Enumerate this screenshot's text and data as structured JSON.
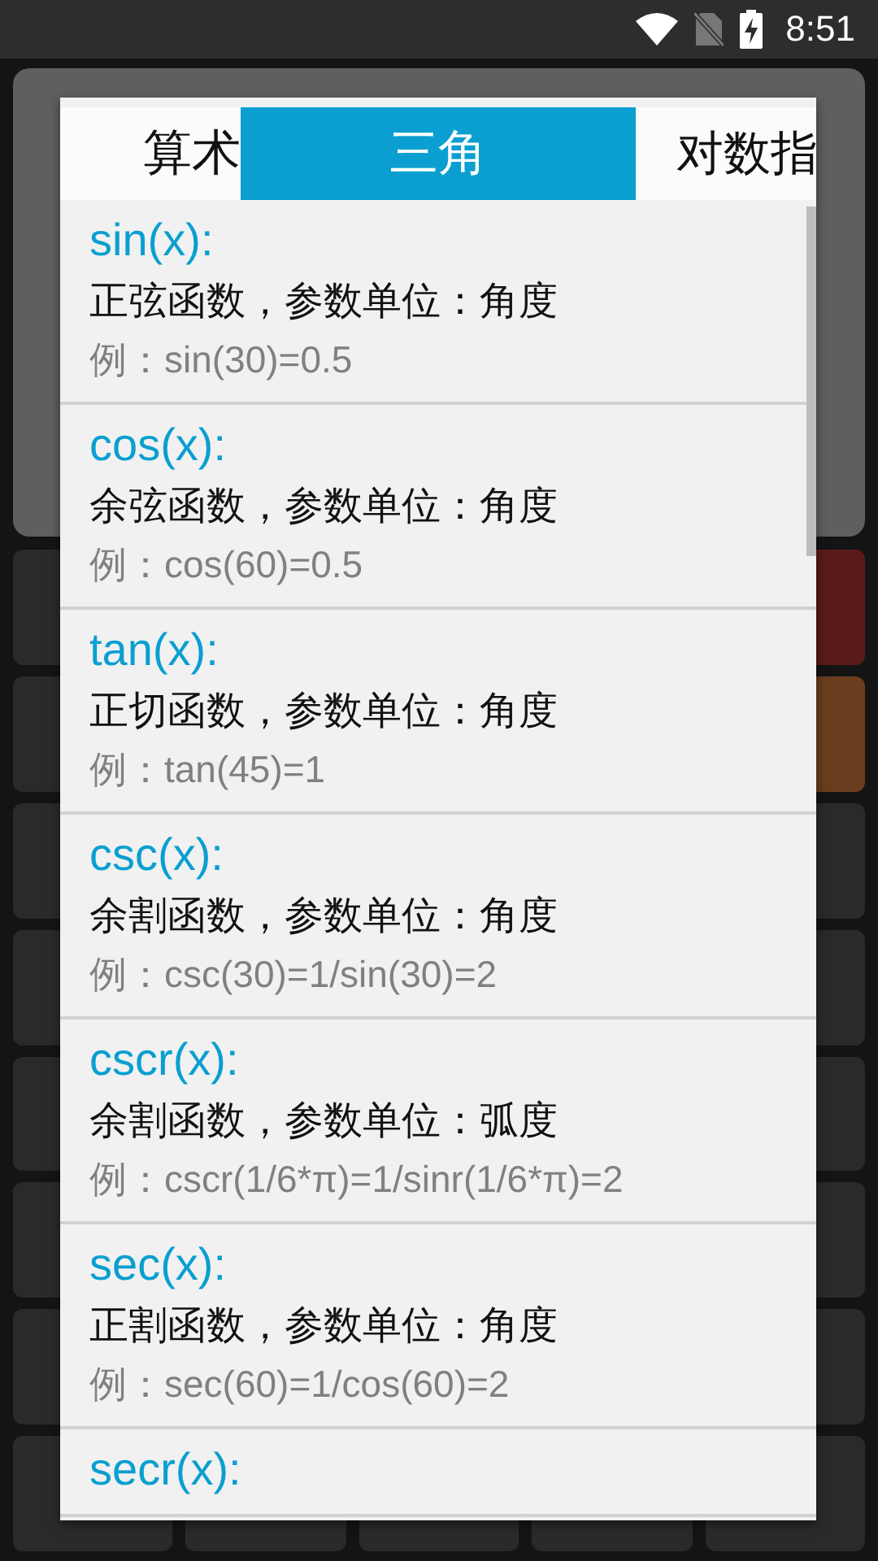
{
  "status_bar": {
    "time": "8:51"
  },
  "dialog": {
    "tabs": [
      {
        "label": "算术",
        "selected": false
      },
      {
        "label": "三角",
        "selected": true
      },
      {
        "label": "对数指",
        "selected": false
      }
    ],
    "functions": [
      {
        "name": "sin(x):",
        "description": "正弦函数，参数单位：角度",
        "example": "例：sin(30)=0.5"
      },
      {
        "name": "cos(x):",
        "description": "余弦函数，参数单位：角度",
        "example": "例：cos(60)=0.5"
      },
      {
        "name": "tan(x):",
        "description": "正切函数，参数单位：角度",
        "example": "例：tan(45)=1"
      },
      {
        "name": "csc(x):",
        "description": "余割函数，参数单位：角度",
        "example": "例：csc(30)=1/sin(30)=2"
      },
      {
        "name": "cscr(x):",
        "description": "余割函数，参数单位：弧度",
        "example": "例：cscr(1/6*π)=1/sinr(1/6*π)=2"
      },
      {
        "name": "sec(x):",
        "description": "正割函数，参数单位：角度",
        "example": "例：sec(60)=1/cos(60)=2"
      },
      {
        "name": "secr(x):"
      }
    ]
  }
}
